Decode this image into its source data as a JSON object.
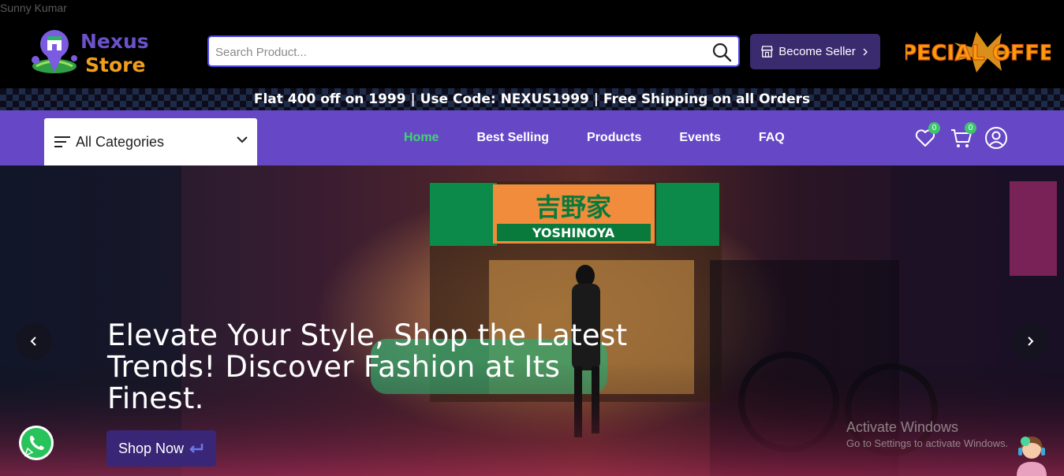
{
  "author": "Sunny Kumar",
  "logo": {
    "line1": "Nexus",
    "line2": "Store"
  },
  "search": {
    "placeholder": "Search Product..."
  },
  "header": {
    "become_seller": "Become Seller",
    "offer_text": "SPECIAL OFFER"
  },
  "promo": {
    "text": "Flat 400 off on 1999 | Use Code: NEXUS1999 | Free Shipping on all Orders"
  },
  "nav": {
    "categories_label": "All Categories",
    "links": [
      {
        "label": "Home",
        "active": true
      },
      {
        "label": "Best Selling",
        "active": false
      },
      {
        "label": "Products",
        "active": false
      },
      {
        "label": "Events",
        "active": false
      },
      {
        "label": "FAQ",
        "active": false
      }
    ],
    "wishlist_count": "0",
    "cart_count": "0"
  },
  "hero": {
    "title": "Elevate Your Style, Shop the Latest Trends! Discover Fashion at Its Finest.",
    "shop_now": "Shop Now",
    "sign_text": "吉野家",
    "sign_brand": "YOSHINOYA"
  },
  "overlay": {
    "activate_title": "Activate Windows",
    "activate_sub": "Go to Settings to activate Windows."
  },
  "colors": {
    "accent": "#6648c7",
    "active_link": "#3ed76b",
    "button_dark": "#3a2677",
    "offer": "#f29e1d"
  }
}
